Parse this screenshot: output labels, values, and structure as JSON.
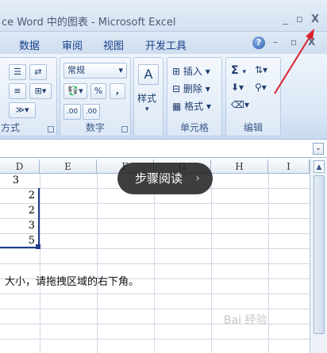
{
  "window": {
    "title": "ce Word 中的图表 - Microsoft Excel",
    "minimize": "_",
    "maximize": "▫",
    "close": "X"
  },
  "menu": {
    "items": [
      "数据",
      "审阅",
      "视图",
      "开发工具"
    ],
    "help": "?",
    "doc_minimize": "–",
    "doc_restore": "▫",
    "doc_close": "X"
  },
  "ribbon": {
    "font_group_label": "方式",
    "number_group": {
      "format_value": "常规",
      "percent": "%",
      "comma": ",",
      "inc_decimal": ".00",
      "dec_decimal": ".00",
      "label": "数字"
    },
    "styles_group": {
      "label": "样式"
    },
    "cells_group": {
      "insert": "插入",
      "delete": "删除",
      "format": "格式",
      "label": "单元格"
    },
    "edit_group": {
      "sum": "Σ",
      "label": "编辑"
    }
  },
  "columns": [
    "D",
    "E",
    "F",
    "G",
    "H",
    "I"
  ],
  "cells": {
    "d1": "3",
    "d2": "2",
    "d3": "2",
    "d4": "3",
    "d5": "5"
  },
  "note": "大小，请拖拽区域的右下角。",
  "tooltip": {
    "label": "步骤阅读",
    "chevron": "›"
  },
  "watermark": "Bai 经验",
  "colors": {
    "arrow": "#d9232f",
    "accent": "#15428b"
  }
}
